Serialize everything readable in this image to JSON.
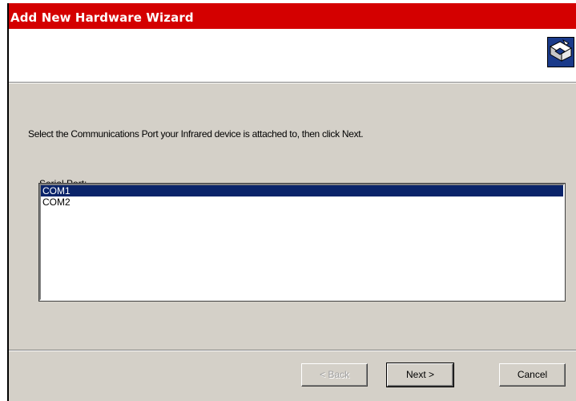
{
  "window": {
    "title": "Add New Hardware Wizard"
  },
  "header": {
    "icon": "hardware-wizard-icon"
  },
  "content": {
    "instruction": "Select the Communications Port your Infrared device is attached to, then click Next.",
    "list_label": "Serial Port:",
    "ports": [
      "COM1",
      "COM2"
    ],
    "selected": "COM1"
  },
  "buttons": {
    "back": "< Back",
    "next": "Next >",
    "cancel": "Cancel"
  },
  "colors": {
    "titlebar": "#d40000",
    "selection": "#0a246a",
    "dialog": "#d4d0c8"
  }
}
